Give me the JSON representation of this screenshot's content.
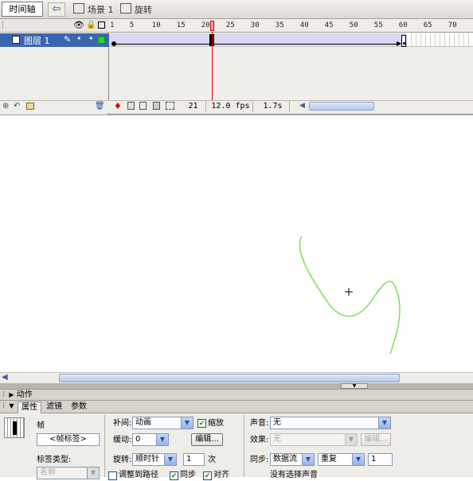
{
  "topbar": {
    "timeline_button": "时间轴",
    "scene_label": "场景 1",
    "symbol_label": "旋转"
  },
  "timeline": {
    "ruler_ticks": [
      "1",
      "5",
      "10",
      "15",
      "20",
      "25",
      "30",
      "35",
      "40",
      "45",
      "50",
      "55",
      "60",
      "65",
      "70"
    ],
    "layer_name": "图层 1",
    "current_frame": 20,
    "status": {
      "frame": "21",
      "fps": "12.0 fps",
      "time": "1.7s"
    }
  },
  "panels": {
    "actions_title": "动作",
    "tabs": [
      "属性",
      "滤镜",
      "参数"
    ],
    "active_tab": "属性"
  },
  "properties": {
    "frame_label": "帧",
    "frame_name_placeholder": "<帧标签>",
    "label_type_label": "标签类型:",
    "label_type_value": "名称",
    "tween_label": "补间:",
    "tween_value": "动画",
    "scale_label": "缩放",
    "ease_label": "缓动:",
    "ease_value": "0",
    "edit_button": "编辑...",
    "rotate_label": "旋转:",
    "rotate_value": "顺时针",
    "rotate_times": "1",
    "times_unit": "次",
    "orient_label": "调整到路径",
    "sync_check_label": "同步",
    "snap_label": "对齐",
    "sound_label": "声音:",
    "sound_value": "无",
    "effect_label": "效果:",
    "effect_value": "无",
    "effect_edit_button": "编辑...",
    "sync_label": "同步:",
    "sync_value": "数据流",
    "repeat_value": "重复",
    "repeat_count": "1",
    "no_sound_text": "没有选择声音"
  },
  "colors": {
    "stage_curve": "#7ee05a",
    "selected_layer": "#3a66b0",
    "tween_frames": "#dad6f3",
    "playhead": "#dd0000"
  }
}
